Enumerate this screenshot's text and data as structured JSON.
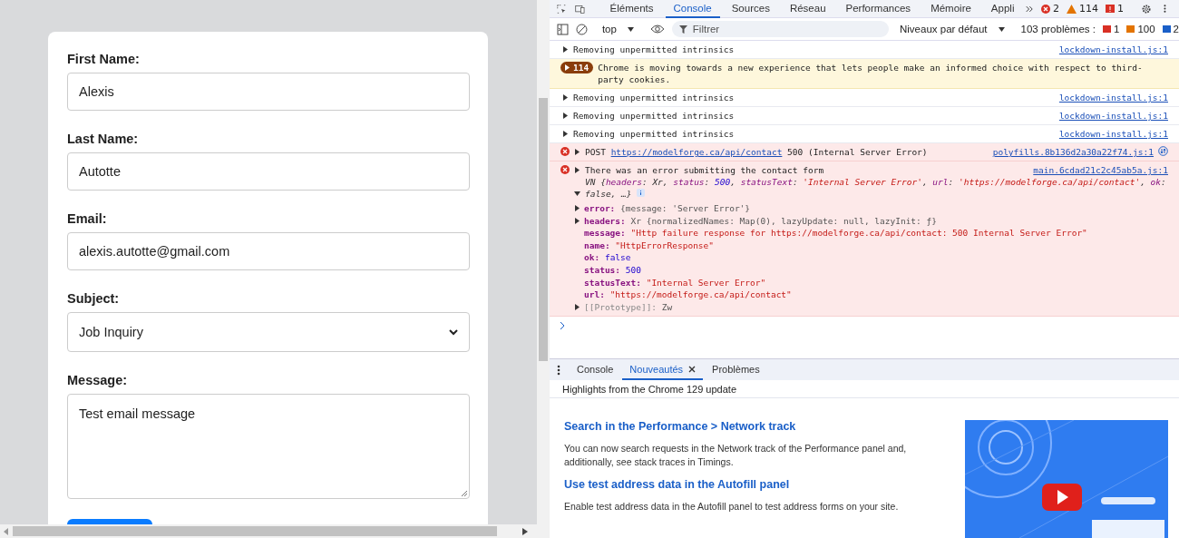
{
  "form": {
    "fields": [
      {
        "label": "First Name:",
        "kind": "text",
        "value": "Alexis"
      },
      {
        "label": "Last Name:",
        "kind": "text",
        "value": "Autotte"
      },
      {
        "label": "Email:",
        "kind": "text",
        "value": "alexis.autotte@gmail.com"
      },
      {
        "label": "Subject:",
        "kind": "select",
        "value": "Job Inquiry"
      },
      {
        "label": "Message:",
        "kind": "textarea",
        "value": "Test email message"
      }
    ]
  },
  "devtools": {
    "tabs": [
      {
        "label": "Éléments",
        "selected": false
      },
      {
        "label": "Console",
        "selected": true
      },
      {
        "label": "Sources",
        "selected": false
      },
      {
        "label": "Réseau",
        "selected": false
      },
      {
        "label": "Performances",
        "selected": false
      },
      {
        "label": "Mémoire",
        "selected": false
      },
      {
        "label": "Appli",
        "selected": false
      }
    ],
    "counters": {
      "errors": "2",
      "warnings": "114",
      "issues": "1"
    },
    "toolbar": {
      "context": "top",
      "filter_placeholder": "Filtrer",
      "levels": "Niveaux par défaut",
      "problems_label": "103 problèmes :",
      "problem_counts": [
        {
          "kind": "error",
          "count": "1"
        },
        {
          "kind": "warning",
          "count": "100"
        },
        {
          "kind": "info",
          "count": "2"
        }
      ]
    },
    "messages": [
      {
        "kind": "log",
        "text": "Removing unpermitted intrinsics",
        "source": "lockdown-install.js:1"
      },
      {
        "kind": "grouped",
        "count": "114",
        "text": "Chrome is moving towards a new experience that lets people make an informed choice with respect to third-party cookies."
      },
      {
        "kind": "log",
        "text": "Removing unpermitted intrinsics",
        "source": "lockdown-install.js:1"
      },
      {
        "kind": "log",
        "text": "Removing unpermitted intrinsics",
        "source": "lockdown-install.js:1"
      },
      {
        "kind": "log",
        "text": "Removing unpermitted intrinsics",
        "source": "lockdown-install.js:1"
      },
      {
        "kind": "network_error",
        "method": "POST",
        "url": "https://modelforge.ca/api/contact",
        "text": "500 (Internal Server Error)",
        "source": "polyfills.8b136d2a30a22f74.js:1"
      },
      {
        "kind": "object_error",
        "text": "There was an error submitting the contact form",
        "source": "main.6cdad21c2c45ab5a.js:1",
        "expanded": true,
        "preview": [
          {
            "text": "VN {",
            "kind": "plain"
          },
          {
            "text": "headers",
            "kind": "key"
          },
          {
            "text": ": Xr, ",
            "kind": "plain"
          },
          {
            "text": "status",
            "kind": "key"
          },
          {
            "text": ": ",
            "kind": "plain"
          },
          {
            "text": "500",
            "kind": "number"
          },
          {
            "text": ", ",
            "kind": "plain"
          },
          {
            "text": "statusText",
            "kind": "key"
          },
          {
            "text": ": ",
            "kind": "plain"
          },
          {
            "text": "'Internal Server Error'",
            "kind": "string"
          },
          {
            "text": ", ",
            "kind": "plain"
          },
          {
            "text": "url",
            "kind": "key"
          },
          {
            "text": ": ",
            "kind": "plain"
          },
          {
            "text": "'https://modelforge.ca/api/contact'",
            "kind": "string"
          },
          {
            "text": ", ",
            "kind": "plain"
          },
          {
            "text": "ok",
            "kind": "key"
          },
          {
            "text": ": false, …}",
            "kind": "plain"
          }
        ],
        "properties": [
          {
            "key": "error:",
            "value": "{message: 'Server Error'}",
            "kind": "object",
            "expandable": true,
            "internal": false
          },
          {
            "key": "headers:",
            "value": "Xr {normalizedNames: Map(0), lazyUpdate: null, lazyInit: ƒ}",
            "kind": "object",
            "expandable": true,
            "internal": false
          },
          {
            "key": "message:",
            "value": "\"Http failure response for https://modelforge.ca/api/contact: 500 Internal Server Error\"",
            "kind": "string",
            "expandable": false,
            "internal": false
          },
          {
            "key": "name:",
            "value": "\"HttpErrorResponse\"",
            "kind": "string",
            "expandable": false,
            "internal": false
          },
          {
            "key": "ok:",
            "value": "false",
            "kind": "boolean",
            "expandable": false,
            "internal": false
          },
          {
            "key": "status:",
            "value": "500",
            "kind": "number",
            "expandable": false,
            "internal": false
          },
          {
            "key": "statusText:",
            "value": "\"Internal Server Error\"",
            "kind": "string",
            "expandable": false,
            "internal": false
          },
          {
            "key": "url:",
            "value": "\"https://modelforge.ca/api/contact\"",
            "kind": "string",
            "expandable": false,
            "internal": false
          },
          {
            "key": "[[Prototype]]:",
            "value": "Zw",
            "kind": "object",
            "expandable": true,
            "internal": true
          }
        ]
      }
    ],
    "drawer": {
      "tabs": [
        {
          "label": "Console",
          "selected": false,
          "closable": false
        },
        {
          "label": "Nouveautés",
          "selected": true,
          "closable": true
        },
        {
          "label": "Problèmes",
          "selected": false,
          "closable": false
        }
      ],
      "subtitle": "Highlights from the Chrome 129 update",
      "articles": [
        {
          "title": "Search in the Performance > Network track",
          "body": "You can now search requests in the Network track of the Performance panel and, additionally, see stack traces in Timings."
        },
        {
          "title": "Use test address data in the Autofill panel",
          "body": "Enable test address data in the Autofill panel to test address forms on your site."
        }
      ]
    }
  }
}
